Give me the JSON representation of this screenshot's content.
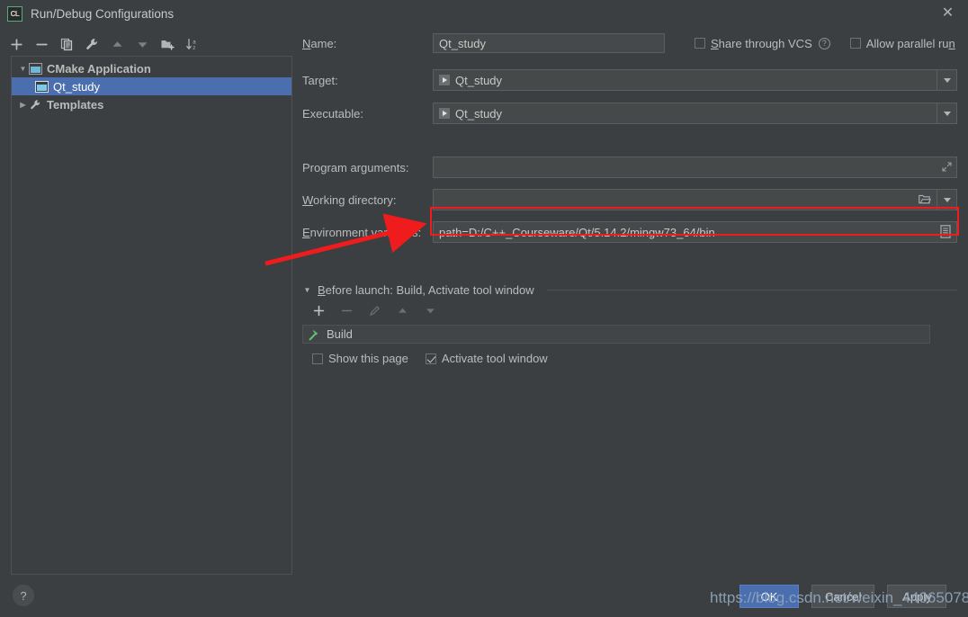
{
  "window": {
    "title": "Run/Debug Configurations",
    "app_icon": "clion-icon",
    "app_icon_label": "CL",
    "close_label": "✕"
  },
  "toolbar": {
    "items": [
      {
        "name": "add-configuration-button",
        "icon": "plus-icon"
      },
      {
        "name": "remove-configuration-button",
        "icon": "minus-icon"
      },
      {
        "name": "copy-configuration-button",
        "icon": "copy-icon"
      },
      {
        "name": "edit-templates-button",
        "icon": "wrench-icon"
      },
      {
        "name": "move-up-button",
        "icon": "arrow-up-icon"
      },
      {
        "name": "move-down-button",
        "icon": "arrow-down-icon"
      },
      {
        "name": "move-into-folder-button",
        "icon": "folder-add-icon"
      },
      {
        "name": "sort-configurations-button",
        "icon": "sort-az-icon"
      }
    ]
  },
  "tree": {
    "nodes": [
      {
        "label": "CMake Application",
        "icon": "application-icon",
        "twisty": "▼",
        "level": 0,
        "bold": true,
        "selected": false
      },
      {
        "label": "Qt_study",
        "icon": "application-icon",
        "twisty": "",
        "level": 1,
        "bold": false,
        "selected": true
      },
      {
        "label": "Templates",
        "icon": "wrench-icon",
        "twisty": "▶",
        "level": 0,
        "bold": true,
        "selected": false
      }
    ]
  },
  "form": {
    "name": {
      "label": "Name:",
      "mnemonic": "N",
      "value": "Qt_study"
    },
    "share_through_vcs": {
      "label": "Share through VCS",
      "mnemonic": "S",
      "checked": false,
      "help_icon": "question-mark-icon",
      "help_glyph": "?"
    },
    "allow_parallel_run": {
      "label": "Allow parallel run",
      "mnemonic": "n",
      "checked": false
    },
    "target": {
      "label": "Target:",
      "value": "Qt_study",
      "icon": "run-target-icon",
      "dropdown_icon": "chevron-down-icon"
    },
    "executable": {
      "label": "Executable:",
      "value": "Qt_study",
      "icon": "run-target-icon",
      "dropdown_icon": "chevron-down-icon"
    },
    "program_arguments": {
      "label": "Program arguments:",
      "mnemonic": "g",
      "value": "",
      "expand_icon": "expand-editor-icon"
    },
    "working_directory": {
      "label": "Working directory:",
      "mnemonic": "W",
      "value": "",
      "browse_icon": "folder-icon",
      "dropdown_icon": "chevron-down-icon"
    },
    "environment_variables": {
      "label": "Environment variables:",
      "mnemonic": "E",
      "value": "path=D:/C++_Courseware/Qt/5.14.2/mingw73_64/bin",
      "edit_icon": "edit-list-icon",
      "highlighted": true
    }
  },
  "before_launch": {
    "title": "Before launch: Build, Activate tool window",
    "mnemonic": "B",
    "twisty": "▼",
    "toolbar": [
      {
        "name": "add-task-button",
        "icon": "plus-icon",
        "enabled": true
      },
      {
        "name": "remove-task-button",
        "icon": "minus-icon",
        "enabled": false
      },
      {
        "name": "edit-task-button",
        "icon": "pencil-icon",
        "enabled": false
      },
      {
        "name": "task-move-up-button",
        "icon": "arrow-up-icon",
        "enabled": false
      },
      {
        "name": "task-move-down-button",
        "icon": "arrow-down-icon",
        "enabled": false
      }
    ],
    "tasks": [
      {
        "label": "Build",
        "icon": "hammer-icon"
      }
    ],
    "show_this_page": {
      "label": "Show this page",
      "checked": false
    },
    "activate_tool_window": {
      "label": "Activate tool window",
      "checked": true
    }
  },
  "footer": {
    "help_label": "?",
    "buttons": [
      {
        "name": "ok-button",
        "label": "OK",
        "primary": true
      },
      {
        "name": "cancel-button",
        "label": "Cancel",
        "primary": false
      },
      {
        "name": "apply-button",
        "label": "Apply",
        "primary": false
      }
    ]
  },
  "annotation": {
    "watermark": "https://blog.csdn.net/weixin_44065078",
    "highlight_color": "#ee1c1c",
    "arrow_color": "#ee1c1c"
  },
  "colors": {
    "background": "#3c3f41",
    "field_background": "#45494a",
    "border": "#5a5e60",
    "selection": "#4b6eaf",
    "text": "#bbbbbb",
    "accent_green": "#4caf7d"
  }
}
